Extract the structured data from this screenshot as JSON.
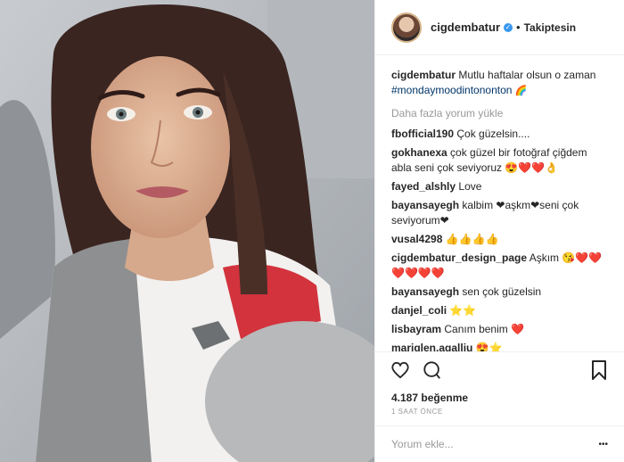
{
  "header": {
    "username": "cigdembatur",
    "follow_label": "Takiptesin",
    "dot": "•"
  },
  "caption": {
    "user": "cigdembatur",
    "text": "Mutlu haftalar olsun o zaman",
    "hashtag": "#mondaymoodintononton",
    "emoji": "🌈"
  },
  "load_more_label": "Daha fazla yorum yükle",
  "comments": [
    {
      "user": "fbofficial190",
      "text": "Çok güzelsin...."
    },
    {
      "user": "gokhanexa",
      "text": "çok güzel bir fotoğraf çiğdem abla seni çok seviyoruz 😍❤️❤️👌"
    },
    {
      "user": "fayed_alshly",
      "text": "Love"
    },
    {
      "user": "bayansayegh",
      "text": "kalbim ❤aşkm❤seni çok seviyorum❤"
    },
    {
      "user": "vusal4298",
      "text": "👍👍👍👍"
    },
    {
      "user": "cigdembatur_design_page",
      "text": "Aşkım 😘❤️❤️❤️❤️❤️❤️"
    },
    {
      "user": "bayansayegh",
      "text": "sen çok güzelsin"
    },
    {
      "user": "danjel_coli",
      "text": "⭐⭐"
    },
    {
      "user": "lisbayram",
      "text": "Canım benim ❤️"
    },
    {
      "user": "mariglen.agalliu",
      "text": "😍⭐"
    }
  ],
  "likes": "4.187 beğenme",
  "timestamp": "1 SAAT ÖNCE",
  "add_comment_placeholder": "Yorum ekle...",
  "more_options": "•••"
}
